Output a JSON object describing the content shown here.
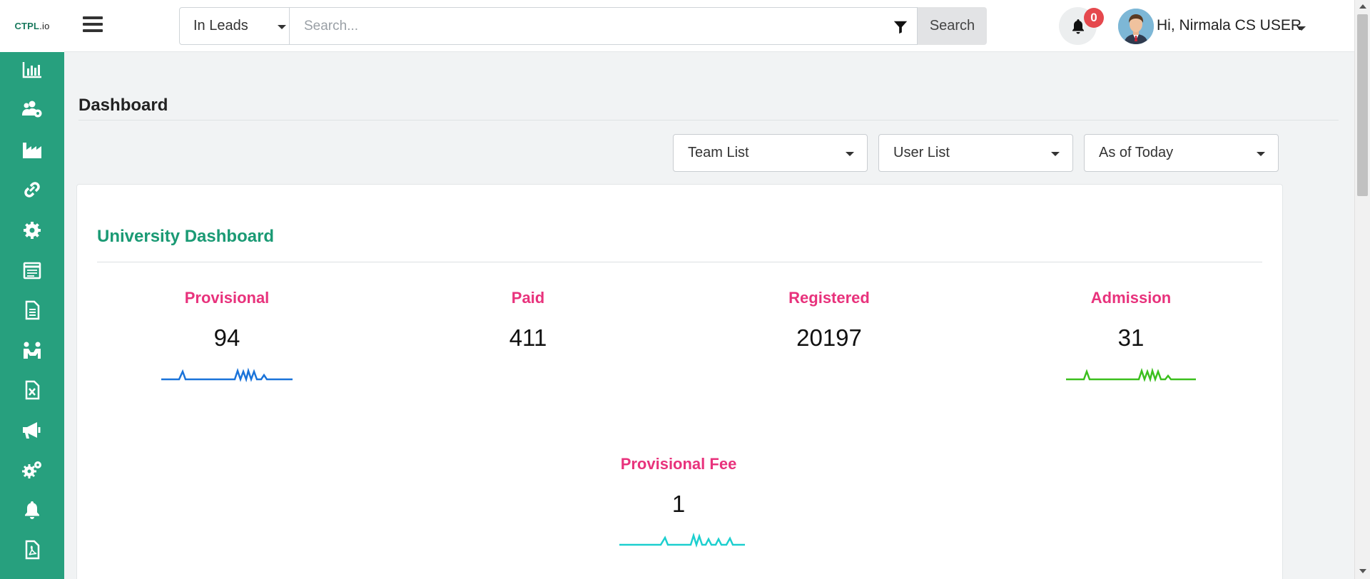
{
  "header": {
    "logo_main": "CTPL",
    "logo_suffix": ".io",
    "search_scope": "In Leads",
    "search_placeholder": "Search...",
    "search_button": "Search",
    "notification_count": "0",
    "user_greeting": "Hi, Nirmala CS USER"
  },
  "sidebar": {
    "items": [
      {
        "icon": "bar-chart-icon"
      },
      {
        "icon": "users-gear-icon"
      },
      {
        "icon": "factory-icon"
      },
      {
        "icon": "link-icon"
      },
      {
        "icon": "gear-icon"
      },
      {
        "icon": "calendar-list-icon"
      },
      {
        "icon": "document-icon"
      },
      {
        "icon": "people-meeting-icon"
      },
      {
        "icon": "excel-file-icon"
      },
      {
        "icon": "megaphone-icon"
      },
      {
        "icon": "gears-icon"
      },
      {
        "icon": "bell-icon"
      },
      {
        "icon": "pdf-file-icon"
      }
    ]
  },
  "page": {
    "title": "Dashboard",
    "filters": {
      "team": "Team List",
      "user": "User List",
      "period": "As of Today"
    }
  },
  "university": {
    "title": "University Dashboard",
    "stats": [
      {
        "label": "Provisional",
        "value": "94",
        "spark_color": "#1a73d9"
      },
      {
        "label": "Paid",
        "value": "411",
        "spark_color": ""
      },
      {
        "label": "Registered",
        "value": "20197",
        "spark_color": ""
      },
      {
        "label": "Admission",
        "value": "31",
        "spark_color": "#3bbf1e"
      },
      {
        "label": "Provisional Fee",
        "value": "1",
        "spark_color": "#1ccfcf"
      }
    ]
  }
}
